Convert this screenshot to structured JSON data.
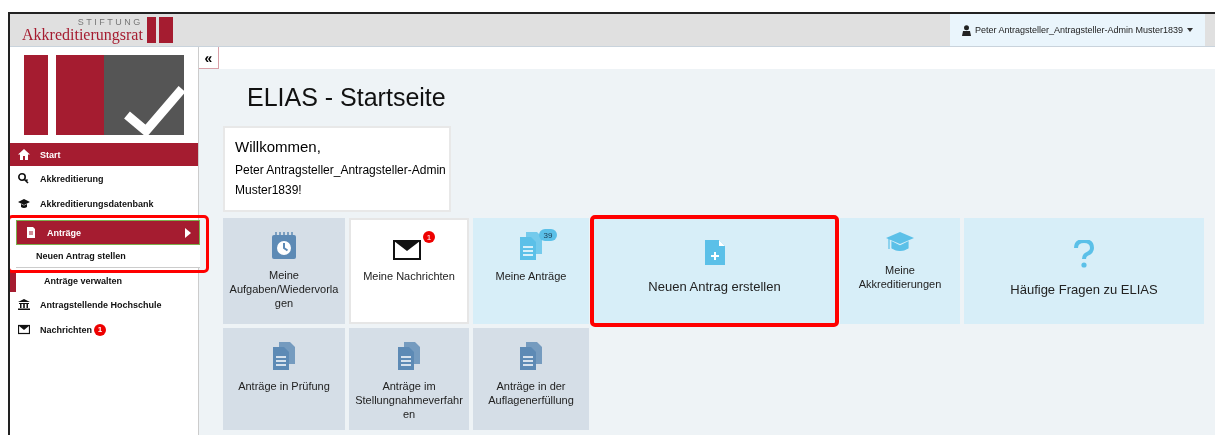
{
  "header": {
    "logo_small_text": "STIFTUNG",
    "logo_text": "Akkreditierungsrat",
    "user_menu": "Peter Antragsteller_Antragsteller-Admin Muster1839"
  },
  "sidebar": {
    "collapse_button": "«",
    "items": [
      {
        "label": "Start",
        "selected": true,
        "expanded": false,
        "highlighted": false
      },
      {
        "label": "Akkreditierung",
        "selected": false,
        "expanded": false,
        "highlighted": false
      },
      {
        "label": "Akkreditierungsdatenbank",
        "selected": false,
        "expanded": false,
        "highlighted": false
      },
      {
        "label": "Anträge",
        "selected": false,
        "expanded": true,
        "highlighted": true,
        "children": [
          {
            "label": "Neuen Antrag stellen",
            "selected": true
          },
          {
            "label": "Anträge verwalten",
            "selected": false
          }
        ]
      },
      {
        "label": "Antragstellende Hochschule",
        "selected": false,
        "expanded": false,
        "highlighted": false
      },
      {
        "label": "Nachrichten",
        "selected": false,
        "expanded": false,
        "highlighted": false,
        "badge": "1"
      }
    ]
  },
  "page": {
    "title": "ELIAS - Startseite",
    "welcome": {
      "greeting": "Willkommen,",
      "name": "Peter Antragsteller_Antragsteller-Admin Muster1839!"
    },
    "tiles": [
      {
        "label": "Meine Aufgaben/Wiedervorlagen",
        "highlighted": false
      },
      {
        "label": "Meine Nachrichten",
        "highlighted": false,
        "badge": "1"
      },
      {
        "label": "Meine Anträge",
        "highlighted": false,
        "badge": "39"
      },
      {
        "label": "Neuen Antrag erstellen",
        "highlighted": true
      },
      {
        "label": "Meine Akkreditierungen",
        "highlighted": false
      },
      {
        "label": "Häufige Fragen zu ELIAS",
        "highlighted": false
      },
      {
        "label": "Anträge in Prüfung",
        "highlighted": false
      },
      {
        "label": "Anträge im Stellungnahmeverfahren",
        "highlighted": false
      },
      {
        "label": "Anträge in der Auflagenerfüllung",
        "highlighted": false
      }
    ]
  }
}
